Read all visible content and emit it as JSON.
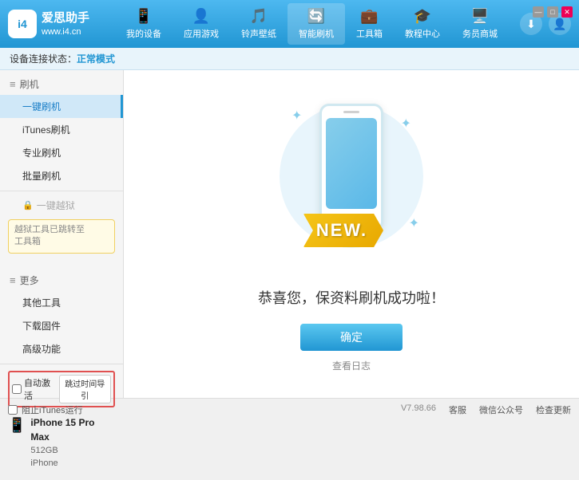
{
  "app": {
    "logo_code": "i4",
    "logo_sub": "www.i4.cn",
    "logo_main": "爱思助手"
  },
  "header": {
    "tabs": [
      {
        "id": "my-device",
        "label": "我的设备",
        "icon": "📱"
      },
      {
        "id": "apps-games",
        "label": "应用游戏",
        "icon": "👤"
      },
      {
        "id": "ringtones",
        "label": "铃声壁纸",
        "icon": "🎵"
      },
      {
        "id": "smart-flash",
        "label": "智能刷机",
        "icon": "🔄"
      },
      {
        "id": "toolbox",
        "label": "工具箱",
        "icon": "💼"
      },
      {
        "id": "tutorials",
        "label": "教程中心",
        "icon": "🎓"
      },
      {
        "id": "merchant",
        "label": "务员商城",
        "icon": "🖥️"
      }
    ]
  },
  "status": {
    "label": "设备连接状态：",
    "mode": "正常模式"
  },
  "sidebar": {
    "section_flash": "刷机",
    "items": [
      {
        "id": "one-key-flash",
        "label": "一键刷机",
        "active": true
      },
      {
        "id": "itunes-flash",
        "label": "iTunes刷机",
        "active": false
      },
      {
        "id": "pro-flash",
        "label": "专业刷机",
        "active": false
      },
      {
        "id": "batch-flash",
        "label": "批量刷机",
        "active": false
      }
    ],
    "disabled_item": "一键越狱",
    "note_line1": "越狱工具已跳转至",
    "note_line2": "工具箱",
    "section_more": "更多",
    "more_items": [
      {
        "id": "other-tools",
        "label": "其他工具"
      },
      {
        "id": "download-firm",
        "label": "下载固件"
      },
      {
        "id": "advanced",
        "label": "高级功能"
      }
    ]
  },
  "device": {
    "auto_activate_label": "自动激活",
    "time_guidance_label": "跳过时间导引",
    "name": "iPhone 15 Pro Max",
    "storage": "512GB",
    "type": "iPhone"
  },
  "content": {
    "new_badge": "NEW.",
    "success_message": "恭喜您，保资料刷机成功啦！",
    "confirm_button": "确定",
    "view_log": "查看日志"
  },
  "footer": {
    "itunes_label": "阻止iTunes运行",
    "version": "V7.98.66",
    "links": [
      "客服",
      "微信公众号",
      "检查更新"
    ]
  },
  "window_controls": {
    "minimize": "—",
    "maximize": "□",
    "close": "✕"
  }
}
